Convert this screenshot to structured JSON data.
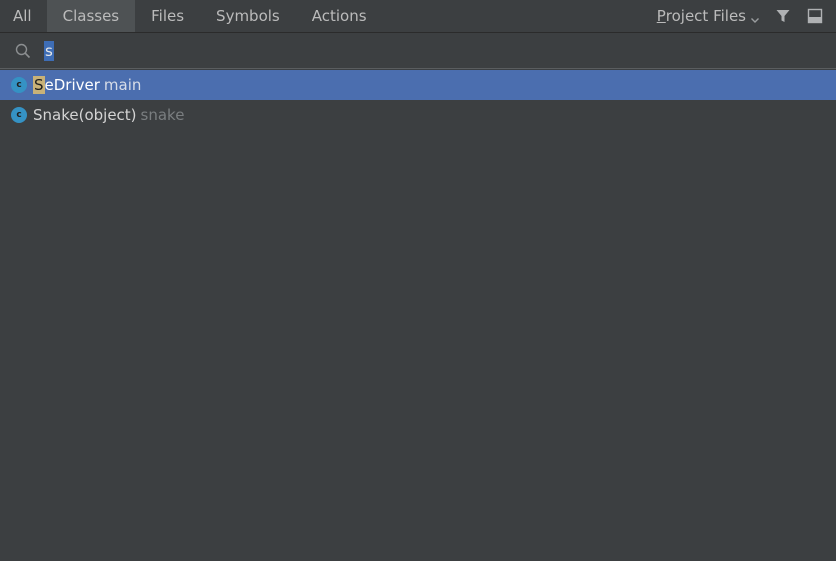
{
  "tabs": [
    {
      "label": "All",
      "selected": false
    },
    {
      "label": "Classes",
      "selected": true
    },
    {
      "label": "Files",
      "selected": false
    },
    {
      "label": "Symbols",
      "selected": false
    },
    {
      "label": "Actions",
      "selected": false
    }
  ],
  "scope": {
    "label_first": "P",
    "label_rest": "roject Files",
    "icon": "chevron-down-icon"
  },
  "toolbar": {
    "filter_icon": "filter-icon",
    "preview_icon": "preview-panel-icon"
  },
  "search": {
    "value": "s",
    "icon": "search-icon"
  },
  "results": [
    {
      "icon": "class-icon",
      "icon_letter": "c",
      "match": "S",
      "name_rest": "eDriver",
      "location": "main",
      "selected": true
    },
    {
      "icon": "class-icon",
      "icon_letter": "c",
      "match": "",
      "name_rest": "Snake(object)",
      "location": "snake",
      "selected": false
    }
  ],
  "colors": {
    "background": "#3c3f41",
    "selected_tab": "#4e5254",
    "selected_row": "#4b6eaf",
    "match_highlight": "#c8b278",
    "class_icon": "#3592c4"
  }
}
